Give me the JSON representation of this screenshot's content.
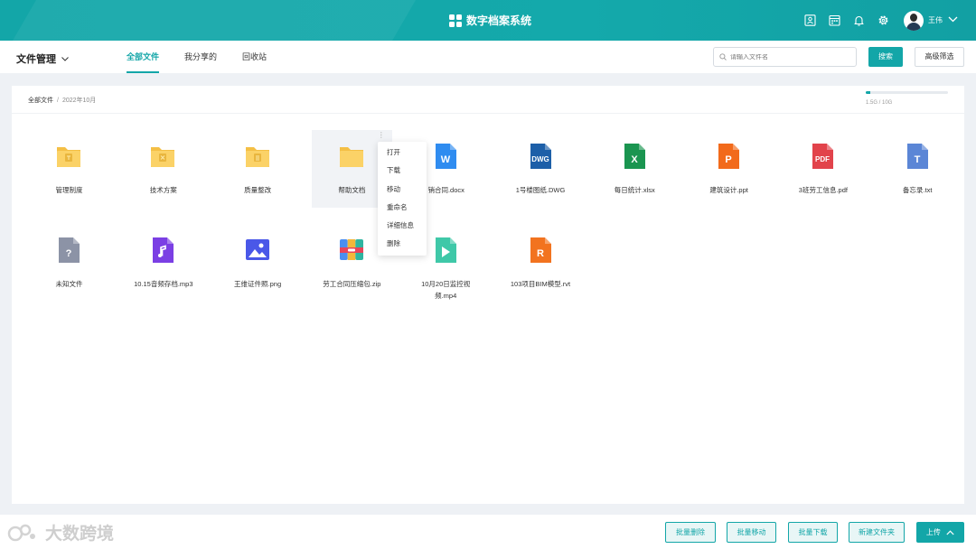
{
  "app": {
    "title": "数字档案系统",
    "user_name": "王伟"
  },
  "subheader": {
    "module": "文件管理",
    "tabs": [
      {
        "label": "全部文件",
        "active": true
      },
      {
        "label": "我分享的",
        "active": false
      },
      {
        "label": "回收站",
        "active": false
      }
    ],
    "search_placeholder": "请输入文件名",
    "search_button": "搜索",
    "advanced_button": "高级筛选"
  },
  "breadcrumb": {
    "root": "全部文件",
    "current": "2022年10月"
  },
  "storage": {
    "used_fraction": 0.055,
    "text": "1.5G / 10G"
  },
  "files": [
    {
      "name": "管理制度",
      "type": "folder",
      "glyph": "doc"
    },
    {
      "name": "技术方案",
      "type": "folder",
      "glyph": "x"
    },
    {
      "name": "质量整改",
      "type": "folder",
      "glyph": "list"
    },
    {
      "name": "帮助文档",
      "type": "folder",
      "glyph": "",
      "hover": true
    },
    {
      "name": "销合同.docx",
      "type": "word",
      "label": "W",
      "color": "#2f8cf0"
    },
    {
      "name": "1号楼图纸.DWG",
      "type": "dwg",
      "label": "DWG",
      "color": "#1d5fa8"
    },
    {
      "name": "每日统计.xlsx",
      "type": "excel",
      "label": "X",
      "color": "#1a9550"
    },
    {
      "name": "建筑设计.ppt",
      "type": "ppt",
      "label": "P",
      "color": "#f26a1b"
    },
    {
      "name": "3班劳工信息.pdf",
      "type": "pdf",
      "label": "PDF",
      "color": "#e2434b"
    },
    {
      "name": "备忘录.txt",
      "type": "txt",
      "label": "T",
      "color": "#5b86d6"
    },
    {
      "name": "未知文件",
      "type": "unknown",
      "label": "?",
      "color": "#8c93a6"
    },
    {
      "name": "10.15音频存档.mp3",
      "type": "audio",
      "color": "#7b3fe4"
    },
    {
      "name": "王维证件照.png",
      "type": "image",
      "color": "#4a58e8"
    },
    {
      "name": "劳工合同压缩包.zip",
      "type": "zip"
    },
    {
      "name": "10月20日监控视频.mp4",
      "type": "video",
      "color": "#3fc8a8"
    },
    {
      "name": "103项目BIM模型.rvt",
      "type": "rvt",
      "label": "R",
      "color": "#f2731f"
    }
  ],
  "context_menu": [
    "打开",
    "下载",
    "移动",
    "重命名",
    "详细信息",
    "删除"
  ],
  "bottom": {
    "watermark": "大数跨境",
    "buttons": [
      "批量删除",
      "批量移动",
      "批量下载",
      "新建文件夹",
      "上传"
    ]
  },
  "colors": {
    "accent": "#13a6a8",
    "folder": "#fbd267"
  }
}
